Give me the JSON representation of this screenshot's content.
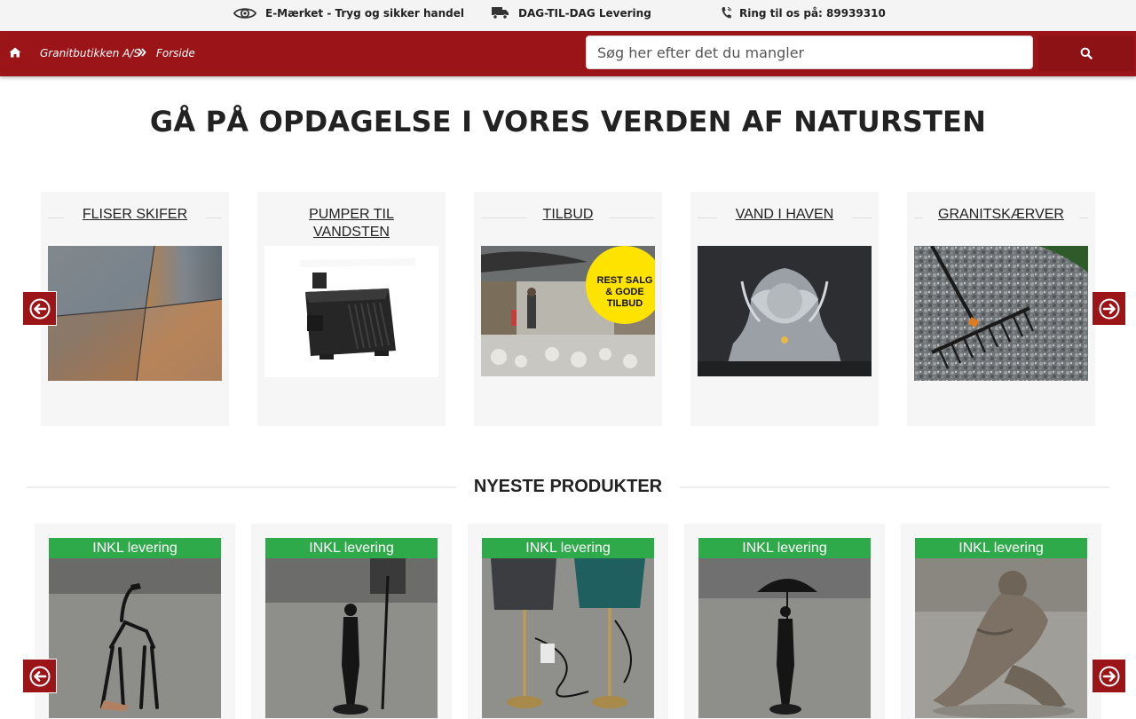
{
  "topbar": {
    "items": [
      {
        "icon": "eye-icon",
        "label": "E-Mærket - Tryg og sikker handel"
      },
      {
        "icon": "truck-icon",
        "label": "DAG-TIL-DAG Levering"
      },
      {
        "icon": "phone-icon",
        "label": "Ring til os på: 89939310"
      }
    ]
  },
  "nav": {
    "breadcrumb": [
      "Granitbutikken A/S",
      "Forside"
    ],
    "search_placeholder": "Søg her efter det du mangler"
  },
  "headline": "GÅ PÅ OPDAGELSE I VORES VERDEN AF NATURSTEN",
  "categories": [
    {
      "title": "FLISER SKIFER"
    },
    {
      "title": "PUMPER TIL VANDSTEN"
    },
    {
      "title": "TILBUD",
      "image_text": "REST SALG & GODE TILBUD"
    },
    {
      "title": "VAND I HAVEN"
    },
    {
      "title": "GRANITSKÆRVER"
    }
  ],
  "newest": {
    "title": "NYESTE PRODUKTER",
    "products": [
      {
        "badge": "INKL levering"
      },
      {
        "badge": "INKL levering"
      },
      {
        "badge": "INKL levering"
      },
      {
        "badge": "INKL levering"
      },
      {
        "badge": "INKL levering"
      }
    ]
  },
  "colors": {
    "brand_red": "#9b1418",
    "badge_green": "#2eaa4a"
  }
}
